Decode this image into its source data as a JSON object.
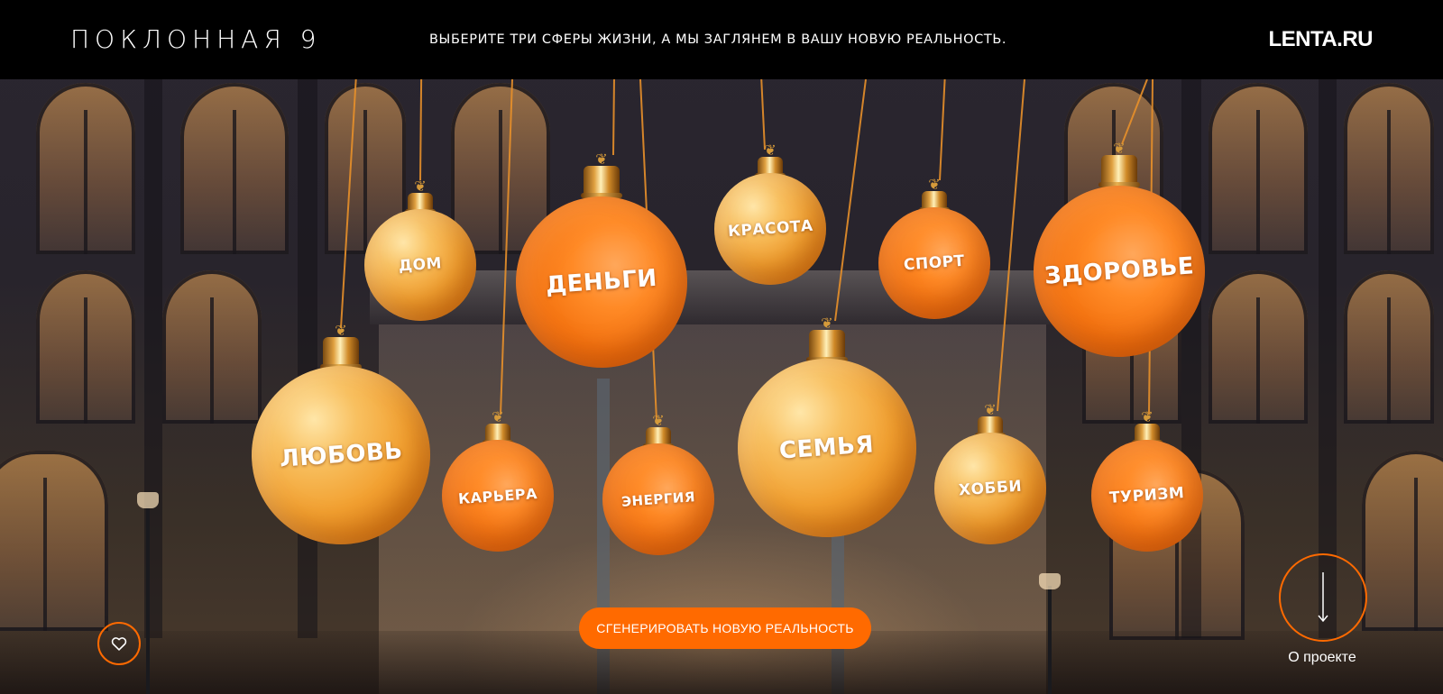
{
  "header": {
    "logo": "ПОКЛОННАЯ 9",
    "tagline": "ВЫБЕРИТЕ ТРИ СФЕРЫ ЖИЗНИ, А МЫ ЗАГЛЯНЕМ В ВАШУ НОВУЮ РЕАЛЬНОСТЬ.",
    "brand": "LENTA.RU"
  },
  "ornaments": [
    {
      "label": "ДОМ",
      "style": "gold"
    },
    {
      "label": "ДЕНЬГИ",
      "style": "orange"
    },
    {
      "label": "КРАСОТА",
      "style": "gold"
    },
    {
      "label": "СПОРТ",
      "style": "orange"
    },
    {
      "label": "ЗДОРОВЬЕ",
      "style": "orange"
    },
    {
      "label": "ЛЮБОВЬ",
      "style": "gold"
    },
    {
      "label": "КАРЬЕРА",
      "style": "orange"
    },
    {
      "label": "ЭНЕРГИЯ",
      "style": "orange"
    },
    {
      "label": "СЕМЬЯ",
      "style": "gold"
    },
    {
      "label": "ХОББИ",
      "style": "gold"
    },
    {
      "label": "ТУРИЗМ",
      "style": "orange"
    }
  ],
  "actions": {
    "generate_label": "СГЕНЕРИРОВАТЬ НОВУЮ РЕАЛЬНОСТЬ",
    "about_label": "О проекте"
  },
  "icons": {
    "favorite": "heart-icon",
    "scroll": "arrow-down-icon"
  },
  "colors": {
    "accent": "#ff6a00",
    "header_bg": "#000000",
    "text": "#ffffff"
  }
}
